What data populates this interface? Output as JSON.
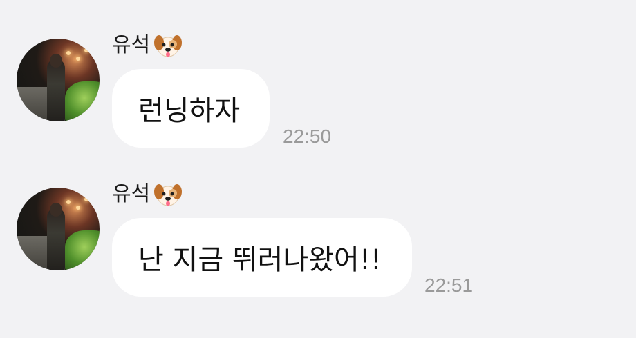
{
  "messages": [
    {
      "sender": "유석",
      "sender_icon": "dog-face-emoji",
      "text": "런닝하자",
      "time": "22:50"
    },
    {
      "sender": "유석",
      "sender_icon": "dog-face-emoji",
      "text": "난 지금 뛰러나왔어!!",
      "time": "22:51"
    }
  ],
  "colors": {
    "background": "#f2f2f4",
    "bubble": "#ffffff",
    "timestamp": "#9a9a9a"
  }
}
